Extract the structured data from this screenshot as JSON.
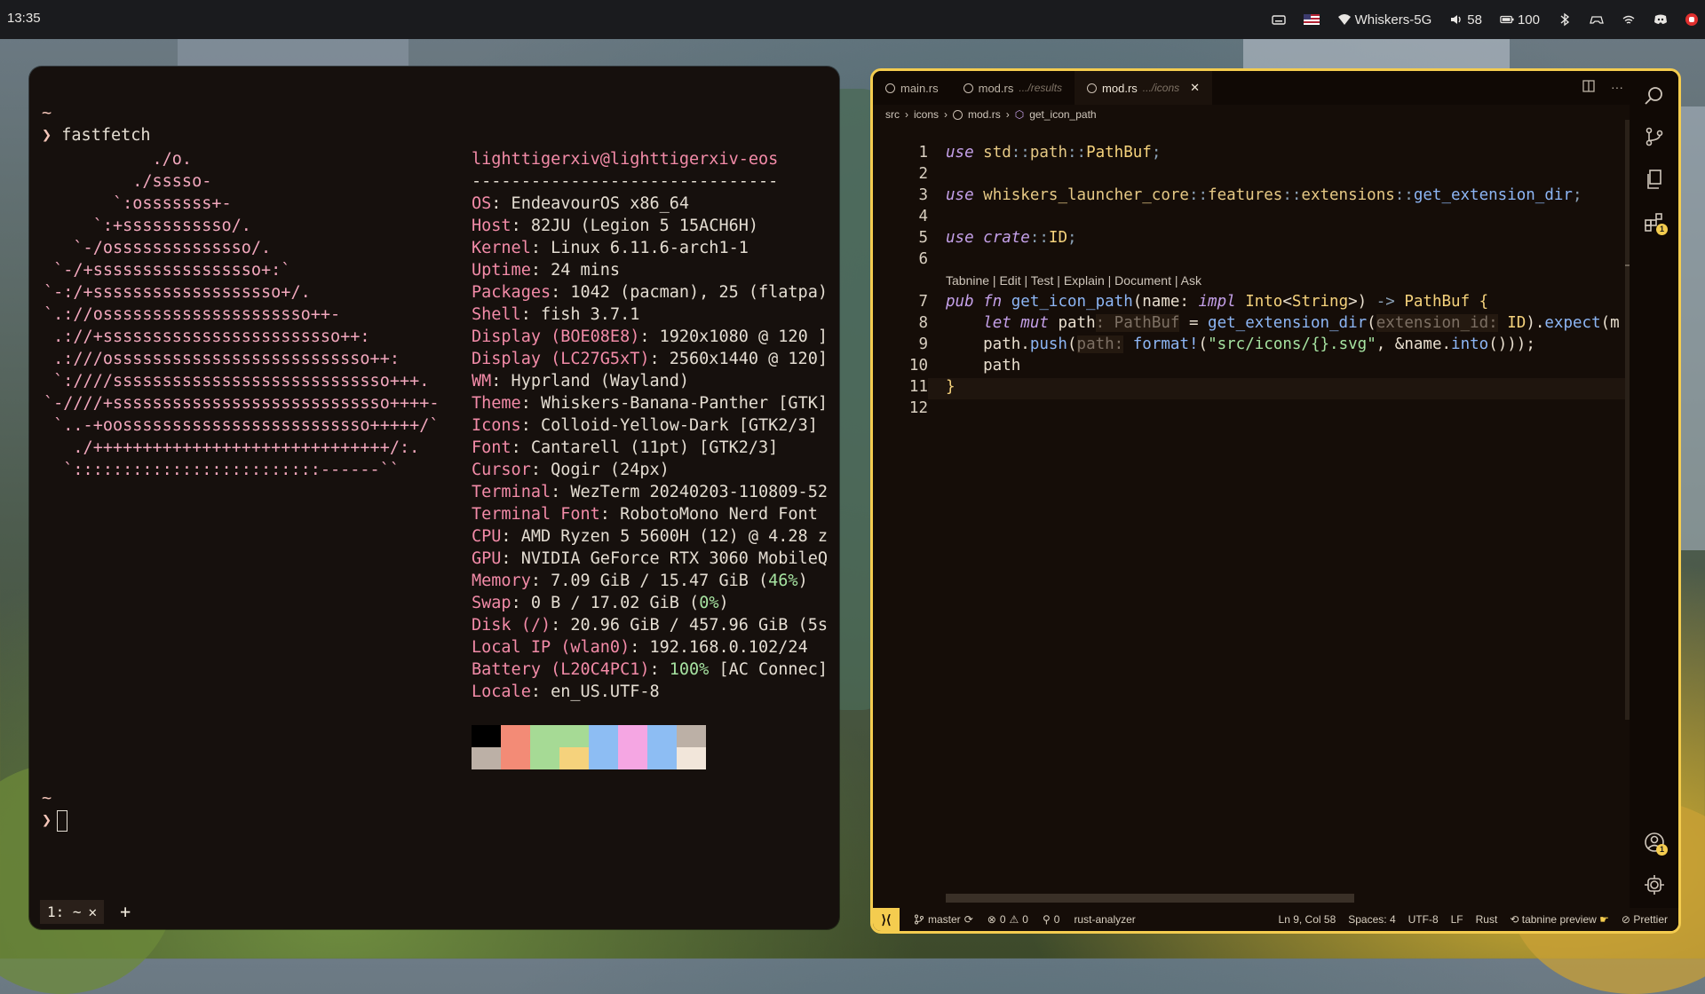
{
  "topbar": {
    "clock": "13:35",
    "wifi_name": "Whiskers-5G",
    "volume": "58",
    "battery": "100"
  },
  "terminal": {
    "prompt_dir": "~",
    "prompt_char": "❯",
    "command": "fastfetch",
    "logo_lines": [
      "           ./o.",
      "         ./sssso-",
      "       `:osssssss+-",
      "     `:+sssssssssso/.",
      "   `-/ossssssssssssso/.",
      " `-/+sssssssssssssssso+:`",
      "`-:/+sssssssssssssssssso+/.",
      "`.://osssssssssssssssssssso++-",
      " .://+ssssssssssssssssssssssso++:",
      " .:///ossssssssssssssssssssssssso++:",
      " `:////ssssssssssssssssssssssssssso+++.",
      "`-////+ssssssssssssssssssssssssssso++++-",
      " `..-+oosssssssssssssssssssssssso+++++/`",
      "   ./++++++++++++++++++++++++++++++/:.",
      "  `:::::::::::::::::::::::::------``"
    ],
    "user_host": "lighttigerxiv@lighttigerxiv-eos",
    "separator": "-------------------------------",
    "info": [
      {
        "key": "OS",
        "value": ": EndeavourOS x86_64"
      },
      {
        "key": "Host",
        "value": ": 82JU (Legion 5 15ACH6H)"
      },
      {
        "key": "Kernel",
        "value": ": Linux 6.11.6-arch1-1"
      },
      {
        "key": "Uptime",
        "value": ": 24 mins"
      },
      {
        "key": "Packages",
        "value": ": 1042 (pacman), 25 (flatpa)"
      },
      {
        "key": "Shell",
        "value": ": fish 3.7.1"
      },
      {
        "key": "Display (BOE08E8)",
        "value": ": 1920x1080 @ 120 ]"
      },
      {
        "key": "Display (LC27G5xT)",
        "value": ": 2560x1440 @ 120]"
      },
      {
        "key": "WM",
        "value": ": Hyprland (Wayland)"
      },
      {
        "key": "Theme",
        "value": ": Whiskers-Banana-Panther [GTK]"
      },
      {
        "key": "Icons",
        "value": ": Colloid-Yellow-Dark [GTK2/3]"
      },
      {
        "key": "Font",
        "value": ": Cantarell (11pt) [GTK2/3]"
      },
      {
        "key": "Cursor",
        "value": ": Qogir (24px)"
      },
      {
        "key": "Terminal",
        "value": ": WezTerm 20240203-110809-52"
      },
      {
        "key": "Terminal Font",
        "value": ": RobotoMono Nerd Font"
      },
      {
        "key": "CPU",
        "value": ": AMD Ryzen 5 5600H (12) @ 4.28 z"
      },
      {
        "key": "GPU",
        "value": ": NVIDIA GeForce RTX 3060 MobileQ"
      }
    ],
    "memory": {
      "key": "Memory",
      "value": ": 7.09 GiB / 15.47 GiB (",
      "pct": "46%",
      "tail": ")"
    },
    "swap": {
      "key": "Swap",
      "value": ": 0 B / 17.02 GiB (",
      "pct": "0%",
      "tail": ")"
    },
    "disk": {
      "key": "Disk (/)",
      "value": ": 20.96 GiB / 457.96 GiB (5s"
    },
    "local_ip": {
      "key": "Local IP (wlan0)",
      "value": ": 192.168.0.102/24"
    },
    "battery": {
      "key": "Battery (L20C4PC1)",
      "value": ": ",
      "pct": "100%",
      "tail": " [AC Connec]"
    },
    "locale": {
      "key": "Locale",
      "value": ": en_US.UTF-8"
    },
    "swatch_colors": [
      "#000000",
      "#f38b76",
      "#a6da95",
      "#a6da95",
      "#8dbdf3",
      "#f5a6e3",
      "#8dbdf3",
      "#bcb0a6",
      "#bcb0a6",
      "#f38b76",
      "#a6da95",
      "#f5d27c",
      "#8dbdf3",
      "#f5a6e3",
      "#8dbdf3",
      "#f2e6da"
    ],
    "tab_label": "1: ~",
    "tab_close": "✕",
    "new_tab": "+"
  },
  "editor": {
    "tabs": [
      {
        "name": "main.rs",
        "path": ""
      },
      {
        "name": "mod.rs",
        "path": ".../results"
      },
      {
        "name": "mod.rs",
        "path": ".../icons"
      }
    ],
    "active_close": "✕",
    "breadcrumb": [
      "src",
      "icons",
      "mod.rs",
      "get_icon_path"
    ],
    "codelens": "Tabnine | Edit | Test | Explain | Document | Ask",
    "line_numbers": [
      "1",
      "2",
      "3",
      "4",
      "5",
      "6",
      "7",
      "8",
      "9",
      "10",
      "11",
      "12"
    ],
    "status": {
      "branch": "master",
      "errors": "0",
      "warnings": "0",
      "ports": "0",
      "analyzer": "rust-analyzer",
      "cursor": "Ln 9, Col 58",
      "spaces": "Spaces: 4",
      "encoding": "UTF-8",
      "eol": "LF",
      "language": "Rust",
      "tabnine": "tabnine preview",
      "prettier": "Prettier"
    },
    "badge_count": "1",
    "accounts_badge": "1"
  }
}
